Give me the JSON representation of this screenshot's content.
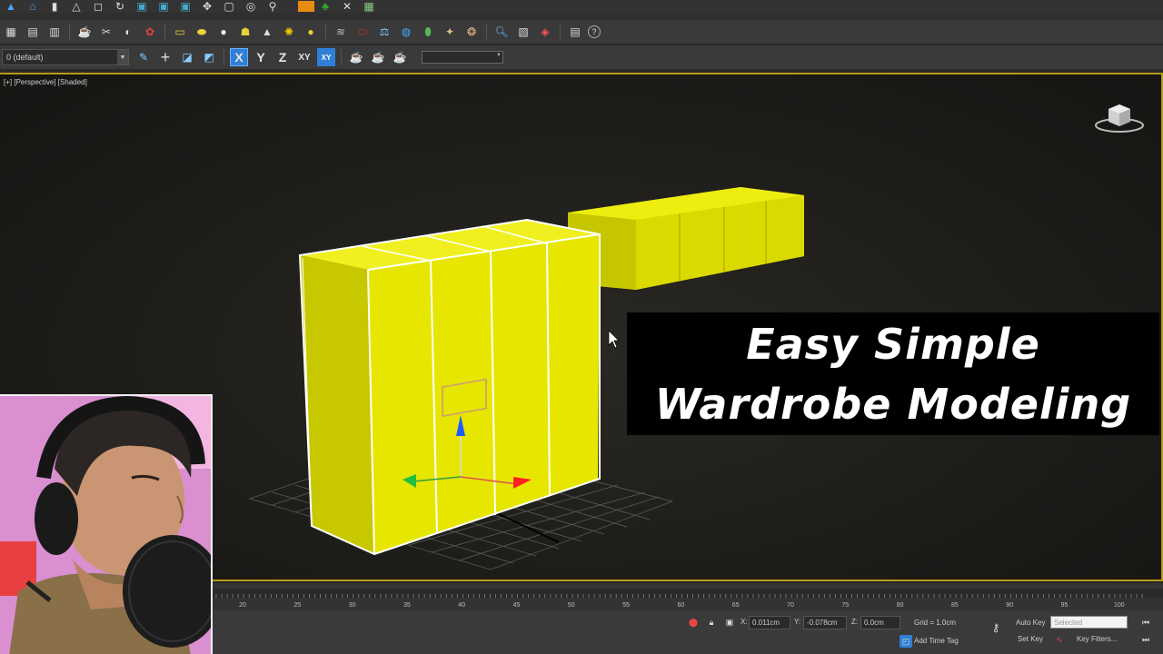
{
  "viewport": {
    "label": "[+] [Perspective] [Shaded]"
  },
  "main_toolbar": {
    "layer_combo_value": "0 (default)"
  },
  "axis_constraints": {
    "x": "X",
    "y": "Y",
    "z": "Z",
    "xy": "XY",
    "xy_badge": "XY"
  },
  "title_overlay": {
    "line1": "Easy Simple",
    "line2": "Wardrobe Modeling"
  },
  "timeline": {
    "ticks": [
      "20",
      "25",
      "30",
      "35",
      "40",
      "45",
      "50",
      "55",
      "60",
      "65",
      "70",
      "75",
      "80",
      "85",
      "90",
      "95",
      "100"
    ]
  },
  "status_bar": {
    "x_label": "X:",
    "x_value": "0.011cm",
    "y_label": "Y:",
    "y_value": "-0.078cm",
    "z_label": "Z:",
    "z_value": "0.0cm",
    "grid": "Grid = 1.0cm",
    "add_time_tag": "Add Time Tag",
    "auto_key": "Auto Key",
    "selected": "Selected",
    "set_key": "Set Key",
    "key_filters": "Key Filters..."
  },
  "colors": {
    "object_yellow": "#e3e300",
    "viewport_border": "#b89a1a",
    "accent_blue": "#2f7fd6"
  }
}
